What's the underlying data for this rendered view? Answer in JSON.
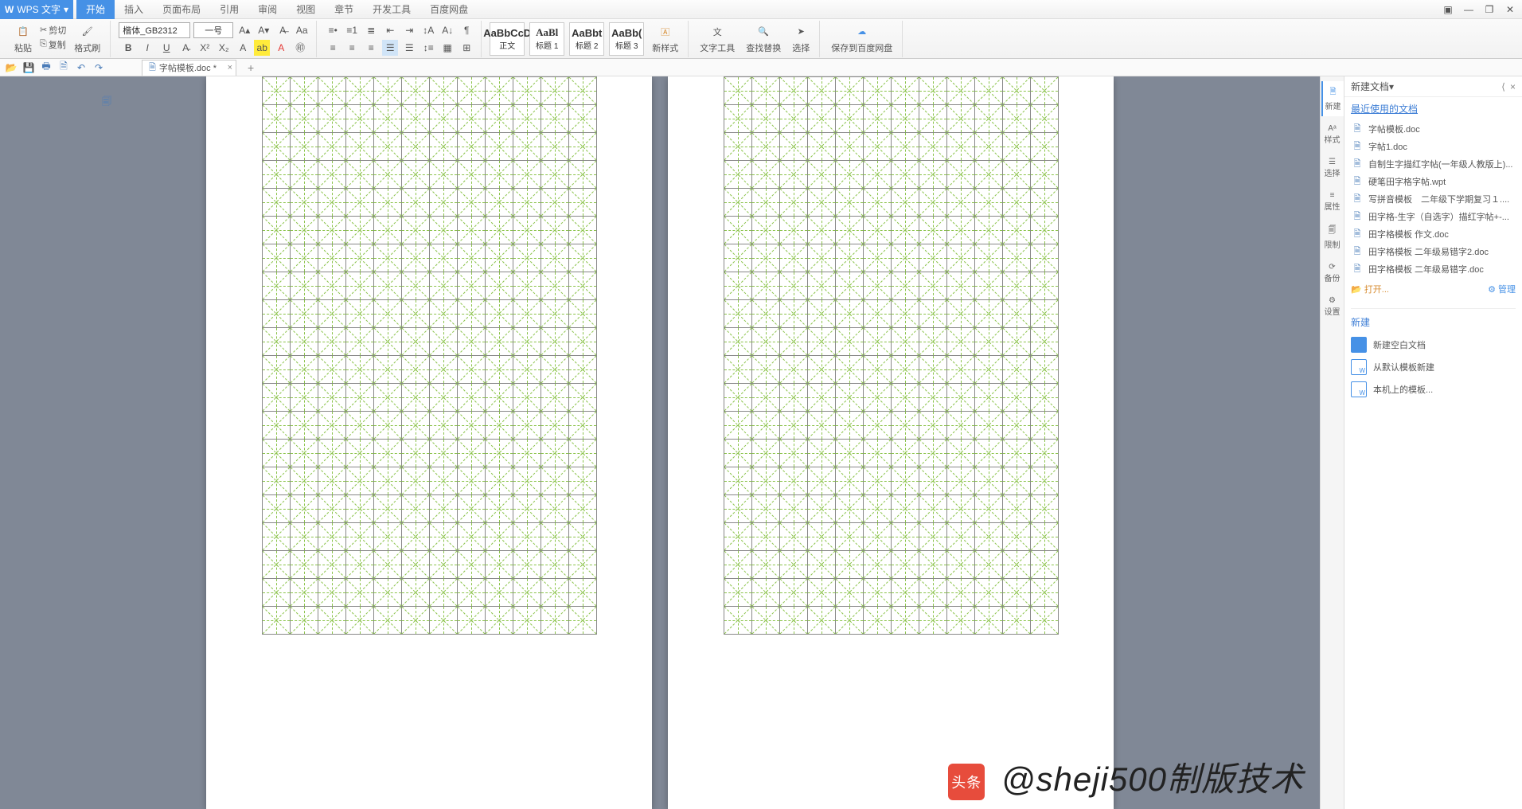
{
  "app": {
    "name": "WPS 文字",
    "doc_tab": "字帖模板.doc *"
  },
  "menu": {
    "items": [
      "开始",
      "插入",
      "页面布局",
      "引用",
      "审阅",
      "视图",
      "章节",
      "开发工具",
      "百度网盘"
    ],
    "active": 0
  },
  "ribbon": {
    "paste": "粘贴",
    "cut": "剪切",
    "copy": "复制",
    "format_painter": "格式刷",
    "font_name": "楷体_GB2312",
    "font_size": "一号",
    "styles": [
      {
        "preview": "AaBbCcD",
        "label": "正文"
      },
      {
        "preview": "AaBl",
        "label": "标题 1"
      },
      {
        "preview": "AaBbt",
        "label": "标题 2"
      },
      {
        "preview": "AaBb(",
        "label": "标题 3"
      }
    ],
    "new_style": "新样式",
    "text_tool": "文字工具",
    "find_replace": "查找替换",
    "select": "选择",
    "save_cloud": "保存到百度网盘"
  },
  "side_tools": [
    "新建",
    "样式",
    "选择",
    "属性",
    "限制",
    "备份",
    "设置"
  ],
  "panel": {
    "title": "新建文档",
    "recent_title": "最近使用的文档",
    "recent": [
      "字帖模板.doc",
      "字帖1.doc",
      "自制生字描红字帖(一年级人教版上)...",
      "硬笔田字格字帖.wpt",
      "写拼音模板　二年级下学期复习１....",
      "田字格-生字（自选字）描红字帖+-...",
      "田字格模板 作文.doc",
      "田字格模板 二年级易错字2.doc",
      "田字格模板 二年级易错字.doc"
    ],
    "open": "打开...",
    "manage": "管理",
    "new_title": "新建",
    "new_items": [
      "新建空白文档",
      "从默认模板新建",
      "本机上的模板..."
    ]
  },
  "watermark": "@sheji500制版技术"
}
